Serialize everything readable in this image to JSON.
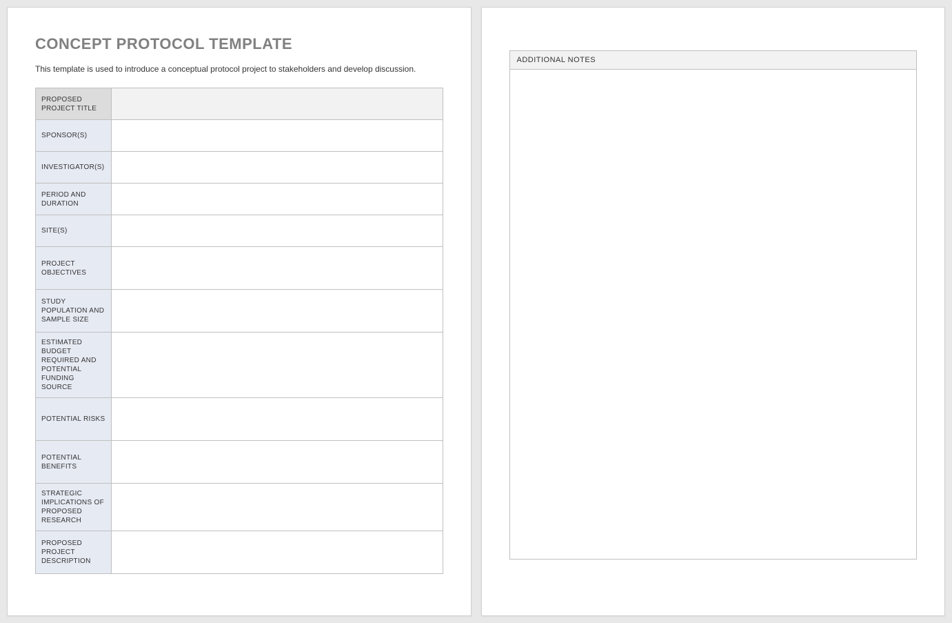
{
  "header": {
    "title": "CONCEPT PROTOCOL TEMPLATE",
    "intro": "This template is used to introduce a conceptual protocol project to stakeholders and develop discussion."
  },
  "rows": [
    {
      "label": "PROPOSED PROJECT TITLE",
      "value": ""
    },
    {
      "label": "SPONSOR(S)",
      "value": ""
    },
    {
      "label": "INVESTIGATOR(S)",
      "value": ""
    },
    {
      "label": "PERIOD AND DURATION",
      "value": ""
    },
    {
      "label": "SITE(S)",
      "value": ""
    },
    {
      "label": "PROJECT OBJECTIVES",
      "value": ""
    },
    {
      "label": "STUDY POPULATION AND SAMPLE SIZE",
      "value": ""
    },
    {
      "label": "ESTIMATED BUDGET REQUIRED AND POTENTIAL FUNDING SOURCE",
      "value": ""
    },
    {
      "label": "POTENTIAL RISKS",
      "value": ""
    },
    {
      "label": "POTENTIAL BENEFITS",
      "value": ""
    },
    {
      "label": "STRATEGIC IMPLICATIONS OF PROPOSED RESEARCH",
      "value": ""
    },
    {
      "label": "PROPOSED PROJECT DESCRIPTION",
      "value": ""
    }
  ],
  "notes": {
    "header": "ADDITIONAL NOTES",
    "body": ""
  }
}
